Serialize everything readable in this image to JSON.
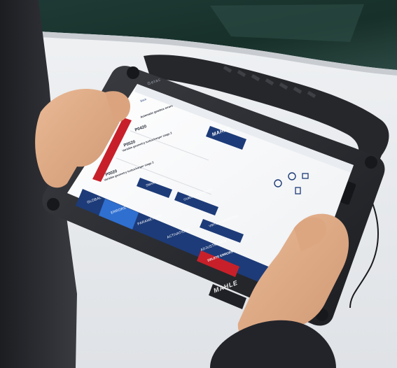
{
  "device": {
    "bezel_brand": "Getac",
    "bezel_logo": "MAHLE"
  },
  "screen": {
    "header_logo": "MAHLE",
    "back_label": "Back",
    "active_dtc_title": "Automatic gearbox errors",
    "dtcs": [
      {
        "code": "P0420"
      },
      {
        "code": "P0520",
        "description": "Variable geometry turbocharger stage 2"
      },
      {
        "code": "P0020",
        "description": "Variable geometry turbocharger stage 2"
      }
    ],
    "buttons": {
      "smart_scan": "SMART SCAN",
      "guided_diagnosis": "GUIDED DIAGNOSIS",
      "virtual_assistant": "VIRTUAL ASSISTANT",
      "delete_errors": "DELETE ERRORS"
    },
    "nav": [
      "GLOBAL",
      "ERRORS",
      "PARAMETERS",
      "ACTIVATIONS",
      "ADJUSTMENTS"
    ]
  },
  "colors": {
    "accent_red": "#c8202a",
    "brand_navy": "#1d3b78",
    "nav_active": "#2f6fd0",
    "sleeve_dark": "#2a2b30",
    "skin": "#e2ad8a"
  }
}
